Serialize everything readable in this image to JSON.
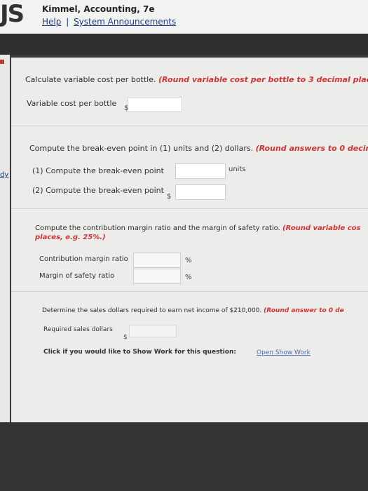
{
  "header": {
    "logo": "JS",
    "title": "Kimmel, Accounting, 7e",
    "help": "Help",
    "separator": "|",
    "announcements": "System Announcements"
  },
  "sidebar": {
    "link": "dy"
  },
  "section1": {
    "prompt": "Calculate variable cost per bottle.",
    "note": "(Round variable cost per bottle to 3 decimal plac",
    "label": "Variable cost per bottle",
    "currency": "$",
    "value": ""
  },
  "section2": {
    "prompt": "Compute the break-even point in (1) units and (2) dollars.",
    "note": "(Round answers to 0 decim",
    "row1_label": "(1)  Compute the break-even point",
    "row1_unit": "units",
    "row1_value": "",
    "row2_label": "(2)  Compute the break-even point",
    "row2_currency": "$",
    "row2_value": ""
  },
  "section3": {
    "prompt": "Compute the contribution margin ratio and the margin of safety ratio.",
    "note1": "(Round variable cos",
    "note2": "places, e.g. 25%.)",
    "row1_label": "Contribution margin ratio",
    "row1_unit": "%",
    "row1_value": "",
    "row2_label": "Margin of safety ratio",
    "row2_unit": "%",
    "row2_value": ""
  },
  "section4": {
    "prompt": "Determine the sales dollars required to earn net income of $210,000.",
    "note": "(Round answer to 0 de",
    "label": "Required sales dollars",
    "currency": "$",
    "value": "",
    "showwork_text": "Click if you would like to Show Work for this question:",
    "showwork_link": "Open Show Work"
  }
}
